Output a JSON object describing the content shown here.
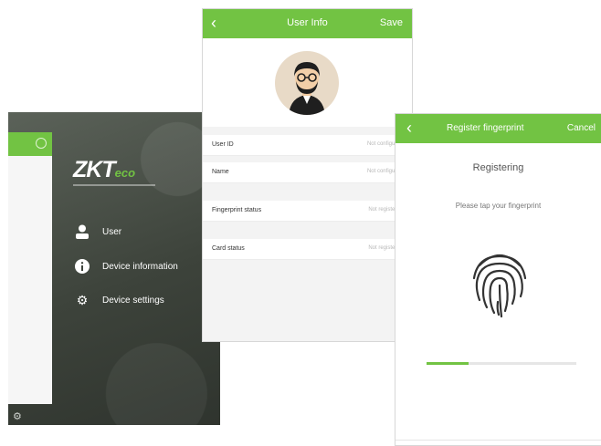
{
  "colors": {
    "accent": "#72c343",
    "menu_bg": "#3d433b"
  },
  "menu_screen": {
    "brand_primary": "ZKT",
    "brand_secondary": "eco",
    "items": [
      {
        "label": "User",
        "icon": "user-icon"
      },
      {
        "label": "Device information",
        "icon": "info-icon"
      },
      {
        "label": "Device settings",
        "icon": "gear-icon"
      }
    ]
  },
  "user_info_screen": {
    "title": "User Info",
    "save_label": "Save",
    "fields": [
      {
        "label": "User ID",
        "value": "Not configured"
      },
      {
        "label": "Name",
        "value": "Not configured"
      },
      {
        "label": "Fingerprint status",
        "value": "Not registered"
      },
      {
        "label": "Card status",
        "value": "Not registered"
      }
    ]
  },
  "fingerprint_screen": {
    "title": "Register fingerprint",
    "cancel_label": "Cancel",
    "status": "Registering",
    "prompt": "Please tap your fingerprint",
    "progress": 0.28
  }
}
